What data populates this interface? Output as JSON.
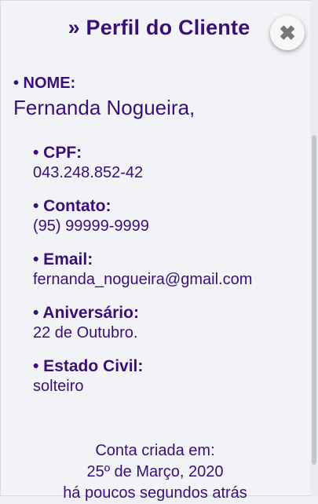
{
  "header": {
    "title": "» Perfil do Cliente",
    "close_icon": "close-icon"
  },
  "client": {
    "name_label": "• NOME:",
    "name": "Fernanda Nogueira,"
  },
  "fields": [
    {
      "label": "• CPF:",
      "value": "043.248.852-42"
    },
    {
      "label": "• Contato:",
      "value": "(95) 99999-9999"
    },
    {
      "label": "• Email:",
      "value": "fernanda_nogueira@gmail.com"
    },
    {
      "label": "• Aniversário:",
      "value": "22 de Outubro."
    },
    {
      "label": "• Estado Civil:",
      "value": "solteiro"
    }
  ],
  "footer": {
    "created_label": "Conta criada em:",
    "created_date": "25º de Março, 2020",
    "relative_time": "há poucos segundos atrás"
  },
  "colors": {
    "accent": "#3b0f7a",
    "background": "#f2f3f6"
  }
}
